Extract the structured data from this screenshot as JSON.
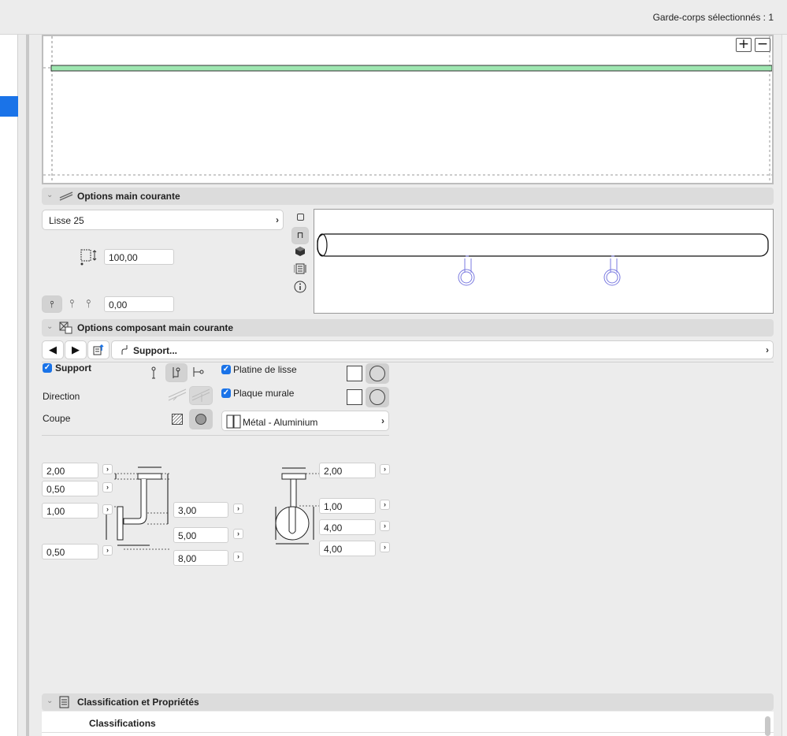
{
  "header": {
    "selection_count_text": "Garde-corps sélectionnés : 1"
  },
  "preview": {
    "zoom_in": "+",
    "zoom_out": "−"
  },
  "main_courante": {
    "title": "Options main courante",
    "profile": "Lisse 25",
    "height_value": "100,00",
    "offset_value": "0,00"
  },
  "composant": {
    "title": "Options composant main courante",
    "selected": "Support...",
    "support_label": "Support",
    "support_checked": true,
    "direction_label": "Direction",
    "coupe_label": "Coupe",
    "platine_label": "Platine de lisse",
    "platine_checked": true,
    "plaque_label": "Plaque murale",
    "plaque_checked": true,
    "material": "Métal - Aluminium",
    "dims_left": [
      "2,00",
      "0,50",
      "1,00",
      "0,50"
    ],
    "dims_mid": [
      "3,00",
      "5,00",
      "8,00"
    ],
    "dims_right": [
      "2,00",
      "1,00",
      "4,00",
      "4,00"
    ]
  },
  "classification": {
    "title": "Classification et Propriétés",
    "subtitle": "Classifications"
  },
  "colors": {
    "accent": "#1a73e8",
    "rail_green": "#9ee6b0",
    "blueprint": "#7a7ae0"
  },
  "icons": [
    "chevron-down-icon",
    "railing-icon",
    "component-icon",
    "arrow-left-icon",
    "arrow-right-icon",
    "component-settings-icon",
    "support-icon",
    "checkbox-icon",
    "list-icon",
    "info-icon",
    "cube-icon"
  ]
}
